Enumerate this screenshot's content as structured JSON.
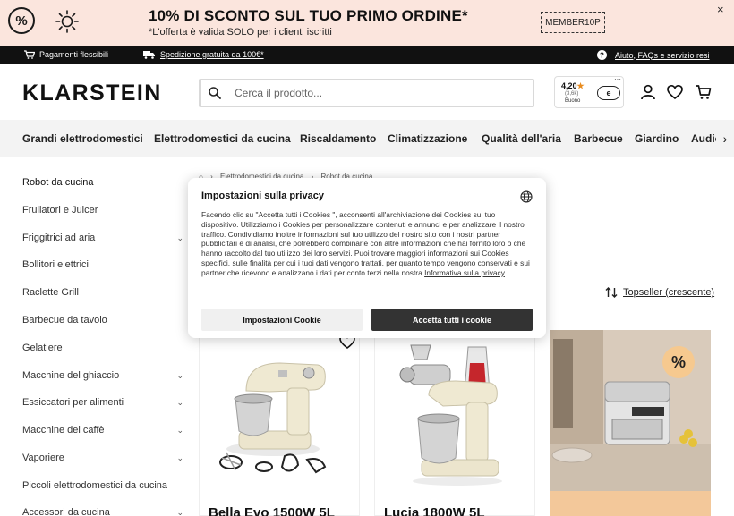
{
  "promo": {
    "title": "10% DI SCONTO SUL TUO PRIMO ORDINE*",
    "subtitle": "*L'offerta è valida SOLO per i clienti iscritti",
    "code": "MEMBER10P",
    "percent_icon_label": "%",
    "close_label": "×"
  },
  "infobar": {
    "flexible_payments": "Pagamenti flessibili",
    "free_shipping": "Spedizione gratuita da 100€*",
    "help": "Aiuto, FAQs e servizio resi"
  },
  "header": {
    "logo": "KLARSTEIN",
    "search_placeholder": "Cerca il prodotto...",
    "rating": {
      "score": "4,20",
      "star": "★",
      "count": "(3,6k)",
      "label": "Buono",
      "badge": "e",
      "more": "···"
    }
  },
  "categories": [
    "Grandi elettrodomestici",
    "Elettrodomestici da cucina",
    "Riscaldamento",
    "Climatizzazione",
    "Qualità dell'aria",
    "Barbecue",
    "Giardino",
    "Audio"
  ],
  "sidebar": {
    "items": [
      {
        "label": "Robot da cucina",
        "chevron": ""
      },
      {
        "label": "Frullatori e Juicer",
        "chevron": ""
      },
      {
        "label": "Friggitrici ad aria",
        "chevron": "⌄"
      },
      {
        "label": "Bollitori elettrici",
        "chevron": ""
      },
      {
        "label": "Raclette Grill",
        "chevron": ""
      },
      {
        "label": "Barbecue da tavolo",
        "chevron": ""
      },
      {
        "label": "Gelatiere",
        "chevron": ""
      },
      {
        "label": "Macchine del ghiaccio",
        "chevron": "⌄"
      },
      {
        "label": "Essiccatori per alimenti",
        "chevron": "⌄"
      },
      {
        "label": "Macchine del caffè",
        "chevron": "⌄"
      },
      {
        "label": "Vaporiere",
        "chevron": "⌄"
      },
      {
        "label": "Piccoli elettrodomestici da cucina",
        "chevron": ""
      },
      {
        "label": "Accessori da cucina",
        "chevron": "⌄"
      }
    ]
  },
  "breadcrumb": {
    "sep": "›",
    "level1": "Elettrodomestici da cucina",
    "level2": "Robot da cucina"
  },
  "sort": {
    "label": "Topseller (crescente)"
  },
  "products": [
    {
      "name": "Bella Evo 1500W 5L"
    },
    {
      "name": "Lucia 1800W 5L"
    }
  ],
  "promo_card": {
    "badge": "%"
  },
  "cookie": {
    "title": "Impostazioni sulla privacy",
    "text": "Facendo clic su \"Accetta tutti i Cookies \", acconsenti all'archiviazione dei Cookies sul tuo dispositivo. Utilizziamo i Cookies per personalizzare contenuti e annunci e per analizzare il nostro traffico. Condividiamo inoltre informazioni sul tuo utilizzo del nostro sito con i nostri partner pubblicitari e di analisi, che potrebbero combinarle con altre informazioni che hai fornito loro o che hanno raccolto dal tuo utilizzo dei loro servizi. Puoi trovare maggiori informazioni sui Cookies specifici, sulle finalità per cui i tuoi dati vengono trattati, per quanto tempo vengono conservati e sui partner che ricevono e analizzano i dati per conto terzi nella nostra",
    "link": "Informativa sulla privacy",
    "after_link": " .",
    "settings_button": "Impostazioni Cookie",
    "accept_button": "Accetta tutti i cookie"
  },
  "colors": {
    "promo_bg": "#fbe5dd",
    "infobar_bg": "#111111",
    "nav_bg": "#f3f3f3",
    "accept_bg": "#333333",
    "star": "#e88b1e"
  }
}
